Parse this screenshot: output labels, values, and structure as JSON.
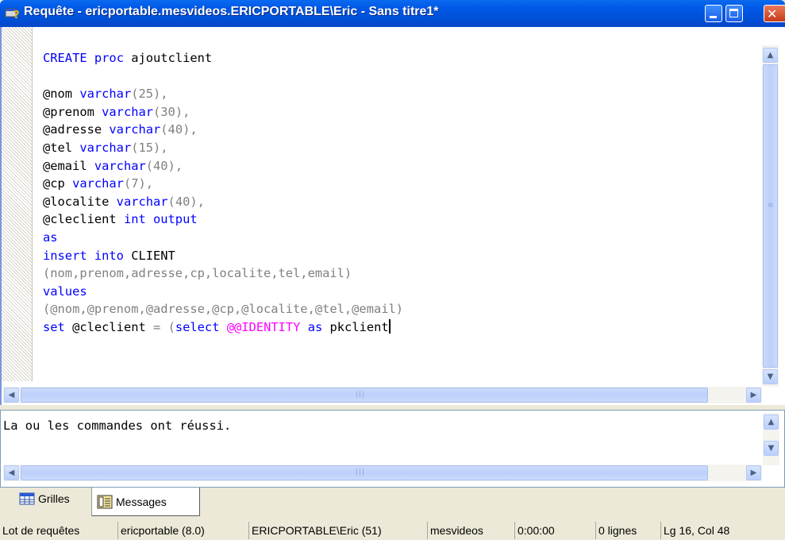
{
  "window": {
    "title": "Requête - ericportable.mesvideos.ERICPORTABLE\\Eric - Sans titre1*",
    "controls": {
      "minimize": "minimize",
      "maximize": "maximize",
      "close": "✕"
    }
  },
  "editor": {
    "lines": [
      [
        {
          "t": "CREATE",
          "c": "kw"
        },
        {
          "t": " "
        },
        {
          "t": "proc",
          "c": "kw"
        },
        {
          "t": " ajoutclient"
        }
      ],
      [],
      [
        {
          "t": "@nom "
        },
        {
          "t": "varchar",
          "c": "kw"
        },
        {
          "t": "(25),",
          "c": "gray"
        }
      ],
      [
        {
          "t": "@prenom "
        },
        {
          "t": "varchar",
          "c": "kw"
        },
        {
          "t": "(30),",
          "c": "gray"
        }
      ],
      [
        {
          "t": "@adresse "
        },
        {
          "t": "varchar",
          "c": "kw"
        },
        {
          "t": "(40),",
          "c": "gray"
        }
      ],
      [
        {
          "t": "@tel "
        },
        {
          "t": "varchar",
          "c": "kw"
        },
        {
          "t": "(15),",
          "c": "gray"
        }
      ],
      [
        {
          "t": "@email "
        },
        {
          "t": "varchar",
          "c": "kw"
        },
        {
          "t": "(40),",
          "c": "gray"
        }
      ],
      [
        {
          "t": "@cp "
        },
        {
          "t": "varchar",
          "c": "kw"
        },
        {
          "t": "(7),",
          "c": "gray"
        }
      ],
      [
        {
          "t": "@localite "
        },
        {
          "t": "varchar",
          "c": "kw"
        },
        {
          "t": "(40),",
          "c": "gray"
        }
      ],
      [
        {
          "t": "@cleclient "
        },
        {
          "t": "int output",
          "c": "kw"
        }
      ],
      [
        {
          "t": "as",
          "c": "kw"
        }
      ],
      [
        {
          "t": "insert into",
          "c": "kw"
        },
        {
          "t": " CLIENT"
        }
      ],
      [
        {
          "t": "(nom,prenom,adresse,cp,localite,tel,email)",
          "c": "gray"
        }
      ],
      [
        {
          "t": "values",
          "c": "kw"
        }
      ],
      [
        {
          "t": "(@nom,@prenom,@adresse,@cp,@localite,@tel,@email)",
          "c": "gray"
        }
      ],
      [
        {
          "t": "set",
          "c": "kw"
        },
        {
          "t": " @cleclient "
        },
        {
          "t": "=",
          "c": "gray"
        },
        {
          "t": " "
        },
        {
          "t": "(",
          "c": "gray"
        },
        {
          "t": "select",
          "c": "kw"
        },
        {
          "t": " "
        },
        {
          "t": "@@IDENTITY",
          "c": "fn"
        },
        {
          "t": " "
        },
        {
          "t": "as",
          "c": "kw"
        },
        {
          "t": " pkclient"
        },
        {
          "t": "|",
          "c": "caret"
        }
      ]
    ]
  },
  "results": {
    "message": "La ou les commandes ont réussi."
  },
  "tabs": [
    {
      "label": "Grilles",
      "icon": "grid-icon",
      "selected": false
    },
    {
      "label": "Messages",
      "icon": "messages-icon",
      "selected": true
    }
  ],
  "statusbar": [
    "Lot de requêtes",
    "ericportable (8.0)",
    "ERICPORTABLE\\Eric (51)",
    "mesvideos",
    "0:00:00",
    "0 lignes",
    "Lg 16, Col 48"
  ]
}
